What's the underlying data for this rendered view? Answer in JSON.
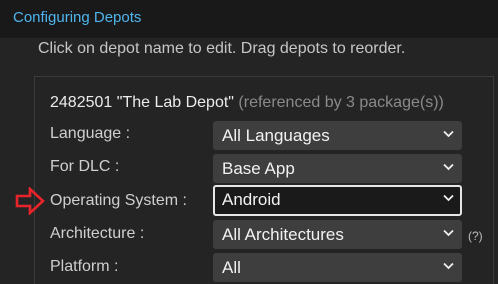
{
  "section": {
    "title": "Configuring Depots",
    "instruction": "Click on depot name to edit. Drag depots to reorder."
  },
  "depot": {
    "id": "2482501",
    "name": "\"The Lab Depot\"",
    "reference": "(referenced by 3 package(s))"
  },
  "rows": [
    {
      "label": "Language :",
      "value": "All Languages"
    },
    {
      "label": "For DLC :",
      "value": "Base App"
    },
    {
      "label": "Operating System :",
      "value": "Android"
    },
    {
      "label": "Architecture :",
      "value": "All Architectures",
      "help": "(?)"
    },
    {
      "label": "Platform :",
      "value": "All"
    }
  ],
  "annotation": {
    "arrow_color": "#e8242a",
    "icon": "red-arrow-icon"
  },
  "colors": {
    "accent": "#4fb5ee",
    "background": "#1e1e1e"
  }
}
